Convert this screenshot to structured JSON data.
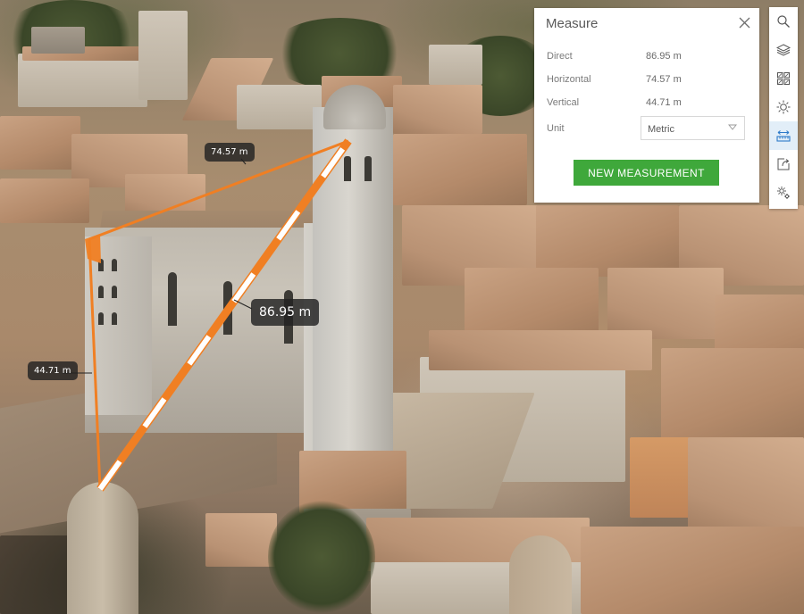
{
  "scene": {
    "description": "3D aerial city mesh view with cathedral"
  },
  "measurement": {
    "labels": {
      "direct": "86.95 m",
      "horizontal": "74.57 m",
      "vertical": "44.71 m"
    },
    "colors": {
      "line": "#f07f23",
      "stripe": "#ffffff",
      "label_bg": "#222222"
    }
  },
  "panel": {
    "title": "Measure",
    "close_icon": "close-icon",
    "rows": [
      {
        "label": "Direct",
        "value": "86.95 m"
      },
      {
        "label": "Horizontal",
        "value": "74.57 m"
      },
      {
        "label": "Vertical",
        "value": "44.71 m"
      }
    ],
    "unit": {
      "label": "Unit",
      "selected": "Metric"
    },
    "new_measurement_label": "NEW MEASUREMENT",
    "button_color": "#3fa83b"
  },
  "toolbar": {
    "tools": [
      {
        "name": "search",
        "icon": "search-icon",
        "active": false
      },
      {
        "name": "layers",
        "icon": "layers-icon",
        "active": false
      },
      {
        "name": "basemap-gallery",
        "icon": "grid-icon",
        "active": false
      },
      {
        "name": "daylight",
        "icon": "sun-icon",
        "active": false
      },
      {
        "name": "measure",
        "icon": "measure-icon",
        "active": true
      },
      {
        "name": "share",
        "icon": "share-icon",
        "active": false
      },
      {
        "name": "settings",
        "icon": "gears-icon",
        "active": false
      }
    ],
    "active_color": "#2c7ac9"
  }
}
